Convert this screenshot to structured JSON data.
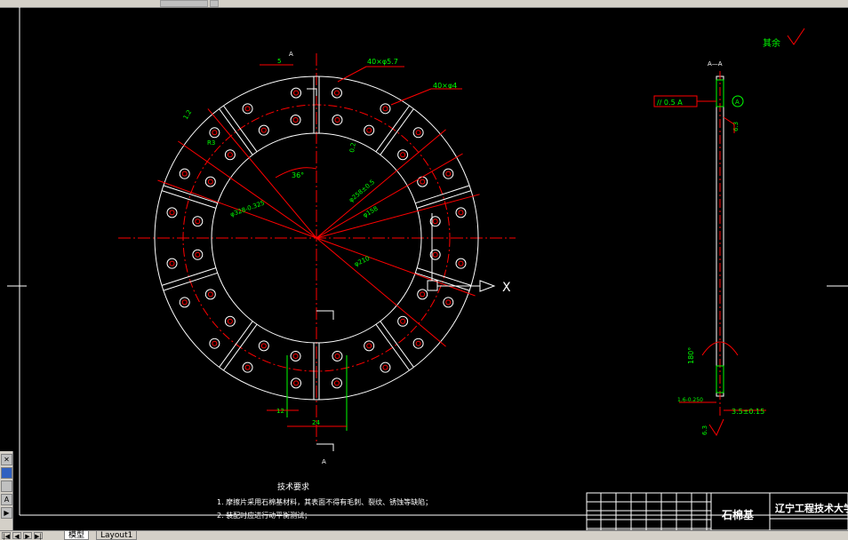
{
  "annotations": {
    "surface_finish": "其余",
    "dim_5": "5",
    "dim_hole1": "40×φ5.7",
    "dim_hole2": "40×φ4",
    "dim_angle": "36°",
    "dim_r3": "R3",
    "dim_12a": "1.2",
    "dim_02": "0.2",
    "dim_outer": "φ328-0.325",
    "dim_d1": "φ258",
    "dim_d2": "φ158",
    "dim_d3": "φ210",
    "dim_pcd": "φ258±0.5",
    "dim_12": "12",
    "dim_24": "24",
    "section_a1": "A",
    "section_a2": "A",
    "section_title": "A—A",
    "tol_parallel": "// 0.5 A",
    "datum": "A",
    "rough_63a": "6.3",
    "rough_63b": "6.3",
    "dim_180": "180°",
    "dim_thick": "1.6-0.250",
    "dim_35": "3.5±0.15",
    "axis_x": "X"
  },
  "tech": {
    "title": "技术要求",
    "line1": "1. 摩擦片采用石棉基材料，其表面不得有毛刺、裂纹、锈蚀等缺陷；",
    "line2": "2. 装配时应进行动平衡测试；"
  },
  "title_block": {
    "part_name": "石棉基",
    "school": "辽宁工程技术大学"
  },
  "tabs": {
    "model": "模型",
    "layout1": "Layout1"
  },
  "colors": {
    "red": "#ff0000",
    "green": "#00ff00",
    "white": "#ffffff",
    "cyan": "#00ffff"
  }
}
